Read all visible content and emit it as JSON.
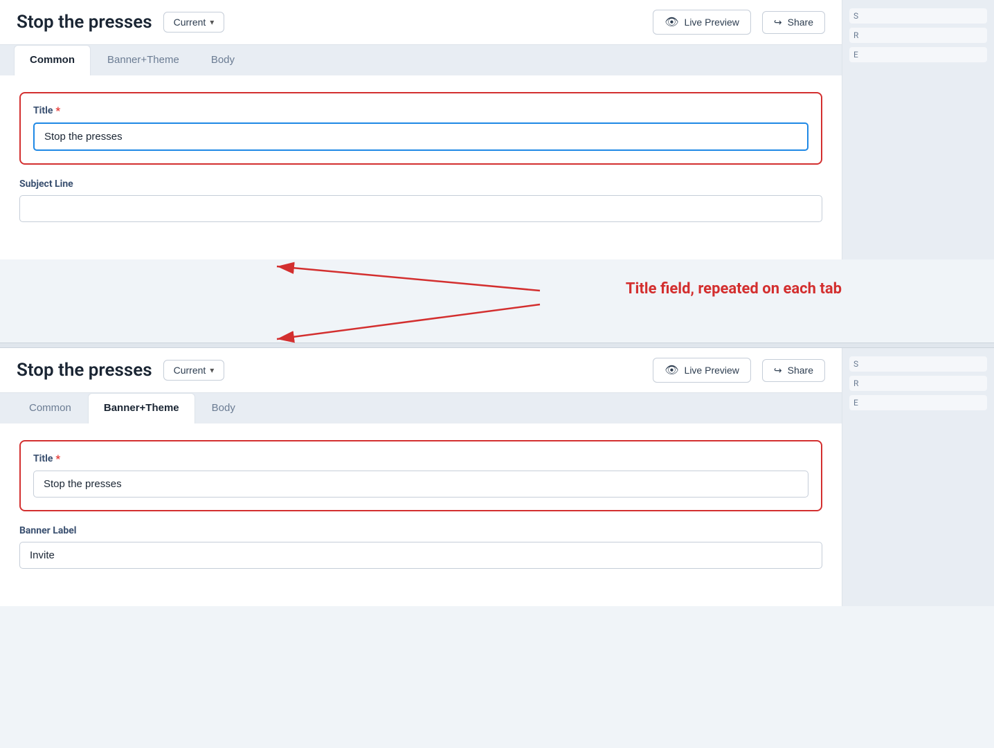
{
  "page_title": "Stop the presses",
  "version_dropdown": {
    "label": "Current",
    "chevron": "▾"
  },
  "header_buttons": {
    "live_preview": "Live Preview",
    "share": "Share"
  },
  "section_top": {
    "tabs": [
      {
        "id": "common",
        "label": "Common",
        "active": true
      },
      {
        "id": "banner_theme",
        "label": "Banner+Theme",
        "active": false
      },
      {
        "id": "body",
        "label": "Body",
        "active": false
      }
    ],
    "title_field": {
      "label": "Title",
      "required": true,
      "value": "Stop the presses",
      "placeholder": ""
    },
    "subject_line_field": {
      "label": "Subject Line",
      "required": false,
      "value": "",
      "placeholder": ""
    }
  },
  "annotation": {
    "text": "Title field, repeated on each tab"
  },
  "section_bottom": {
    "tabs": [
      {
        "id": "common",
        "label": "Common",
        "active": false
      },
      {
        "id": "banner_theme",
        "label": "Banner+Theme",
        "active": true
      },
      {
        "id": "body",
        "label": "Body",
        "active": false
      }
    ],
    "title_field": {
      "label": "Title",
      "required": true,
      "value": "Stop the presses",
      "placeholder": ""
    },
    "banner_label_field": {
      "label": "Banner Label",
      "required": false,
      "value": "Invite",
      "placeholder": ""
    }
  }
}
